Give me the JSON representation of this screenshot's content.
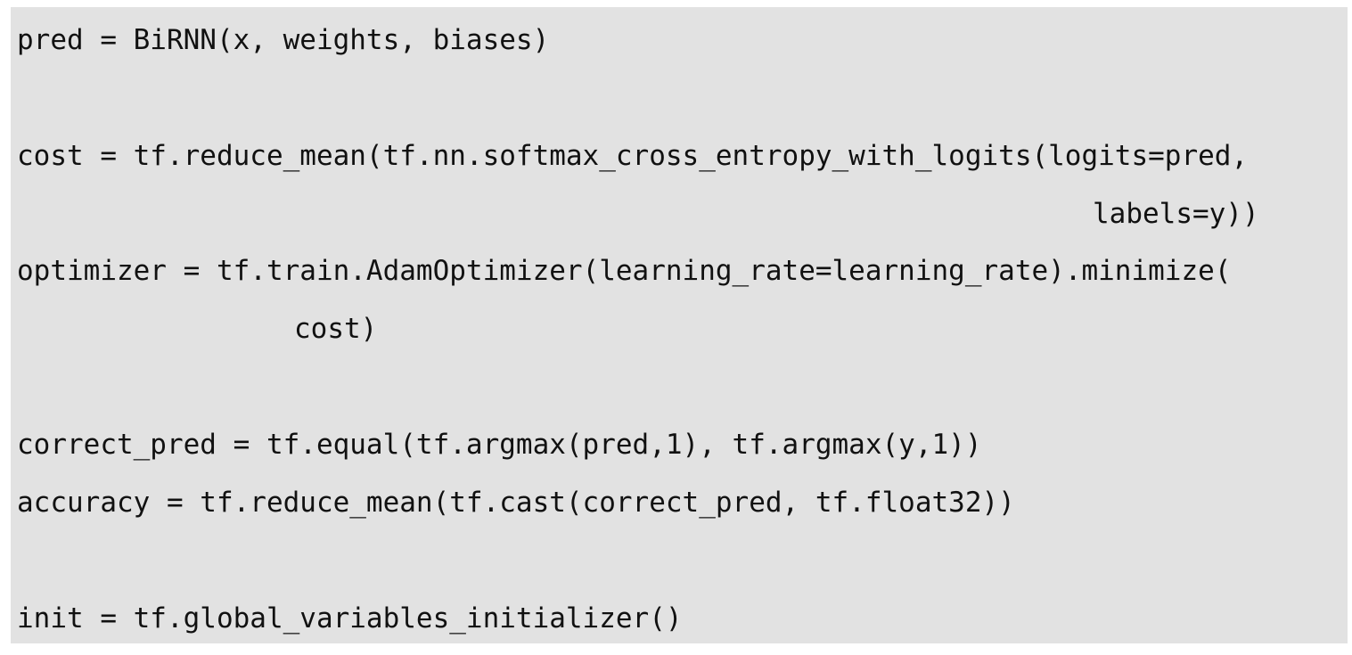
{
  "code_lines": [
    "pred = BiRNN(x, weights, biases)",
    "cost = tf.reduce_mean(tf.nn.softmax_cross_entropy_with_logits(logits=pred,",
    "labels=y))",
    "optimizer = tf.train.AdamOptimizer(learning_rate=learning_rate).minimize(",
    "cost)",
    "correct_pred = tf.equal(tf.argmax(pred,1), tf.argmax(y,1))",
    "accuracy = tf.reduce_mean(tf.cast(correct_pred, tf.float32))",
    "init = tf.global_variables_initializer()"
  ],
  "colors": {
    "background": "#e2e2e2",
    "text": "#111111"
  }
}
